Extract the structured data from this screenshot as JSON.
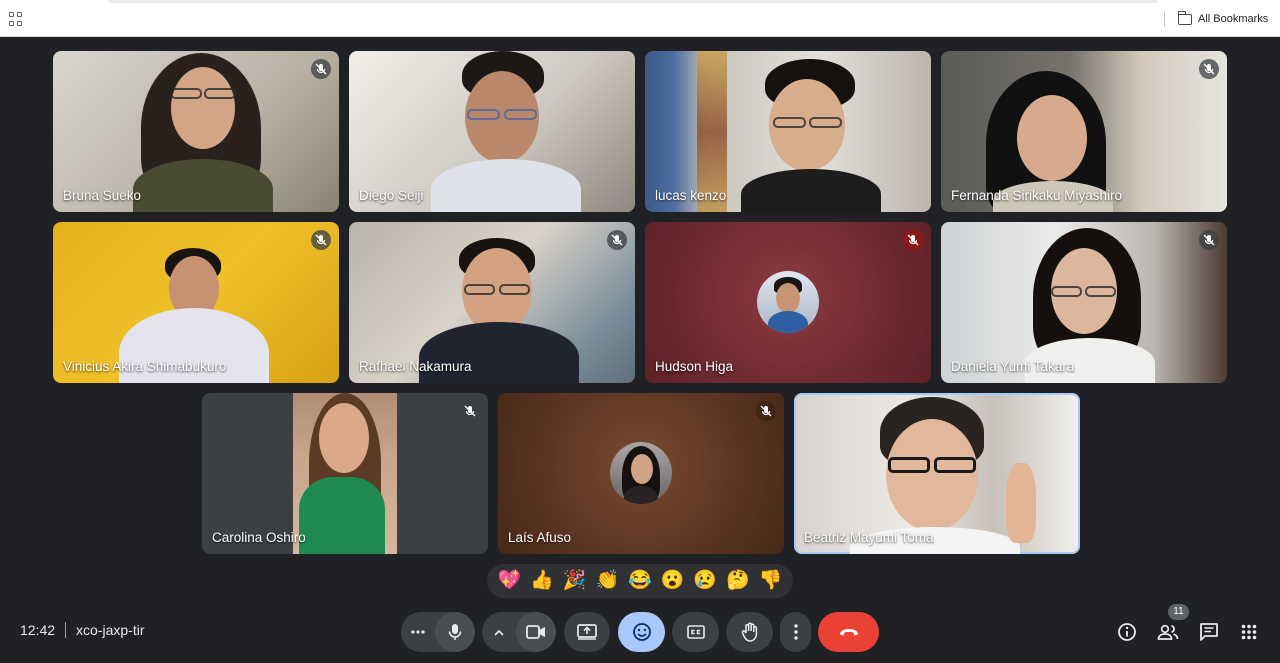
{
  "browser": {
    "bookmarks_label": "All Bookmarks"
  },
  "participants": [
    {
      "name": "Bruna Sueko",
      "muted": true
    },
    {
      "name": "Diego Seiji",
      "muted": false
    },
    {
      "name": "lucas kenzo",
      "muted": false
    },
    {
      "name": "Fernanda Sirikaku Miyashiro",
      "muted": true
    },
    {
      "name": "Vinicius Akira Shimabukuro",
      "muted": true
    },
    {
      "name": "Rafhael Nakamura",
      "muted": true
    },
    {
      "name": "Hudson Higa",
      "muted": true
    },
    {
      "name": "Daniela Yumi Takara",
      "muted": true
    },
    {
      "name": "Carolina Oshiro",
      "muted": true
    },
    {
      "name": "Laís Afuso",
      "muted": true
    },
    {
      "name": "Beatriz Mayumi Toma",
      "muted": false
    }
  ],
  "reactions": [
    "💖",
    "👍",
    "🎉",
    "👏",
    "😂",
    "😮",
    "😢",
    "🤔",
    "👎"
  ],
  "meeting": {
    "time": "12:42",
    "code": "xco-jaxp-tir",
    "participant_count": "11"
  },
  "colors": {
    "background": "#202124",
    "control": "#3c4043",
    "active_control": "#a8c7fa",
    "end_call": "#ea4335"
  }
}
